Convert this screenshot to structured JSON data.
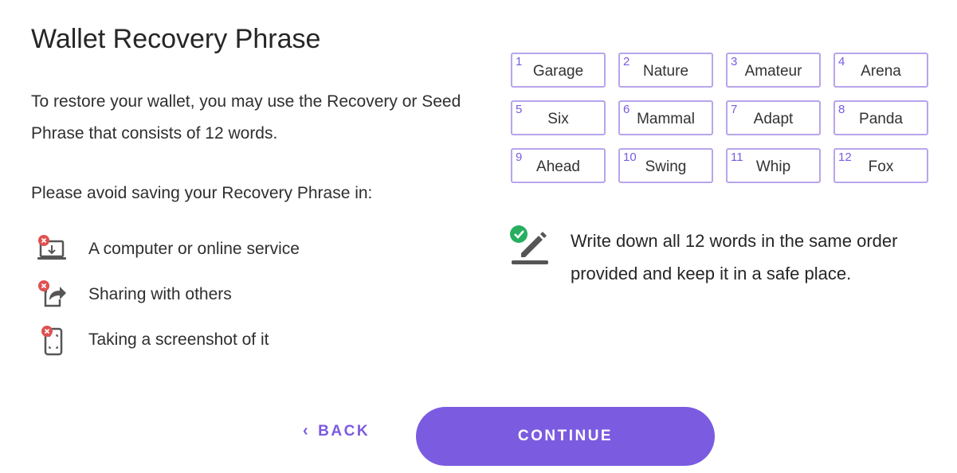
{
  "page": {
    "title": "Wallet Recovery Phrase",
    "intro": "To restore your wallet, you may use the Recovery or Seed Phrase that consists of 12 words.",
    "avoid_heading": "Please avoid saving your Recovery Phrase in:",
    "avoid_items": [
      {
        "label": "A computer or online service",
        "icon": "computer-x-icon"
      },
      {
        "label": "Sharing with others",
        "icon": "share-x-icon"
      },
      {
        "label": "Taking a screenshot of it",
        "icon": "phone-screenshot-x-icon"
      }
    ],
    "words": [
      {
        "num": "1",
        "word": "Garage"
      },
      {
        "num": "2",
        "word": "Nature"
      },
      {
        "num": "3",
        "word": "Amateur"
      },
      {
        "num": "4",
        "word": "Arena"
      },
      {
        "num": "5",
        "word": "Six"
      },
      {
        "num": "6",
        "word": "Mammal"
      },
      {
        "num": "7",
        "word": "Adapt"
      },
      {
        "num": "8",
        "word": "Panda"
      },
      {
        "num": "9",
        "word": "Ahead"
      },
      {
        "num": "10",
        "word": "Swing"
      },
      {
        "num": "11",
        "word": "Whip"
      },
      {
        "num": "12",
        "word": "Fox"
      }
    ],
    "note": "Write down all 12 words in the same order provided and keep it in a safe place.",
    "note_icon": "write-check-icon"
  },
  "buttons": {
    "back_label": "BACK",
    "continue_label": "CONTINUE"
  },
  "colors": {
    "accent": "#7b5be0",
    "word_border": "#b8a5ec",
    "error_red": "#e05050",
    "success_green": "#27ae60",
    "icon_gray": "#555555"
  }
}
